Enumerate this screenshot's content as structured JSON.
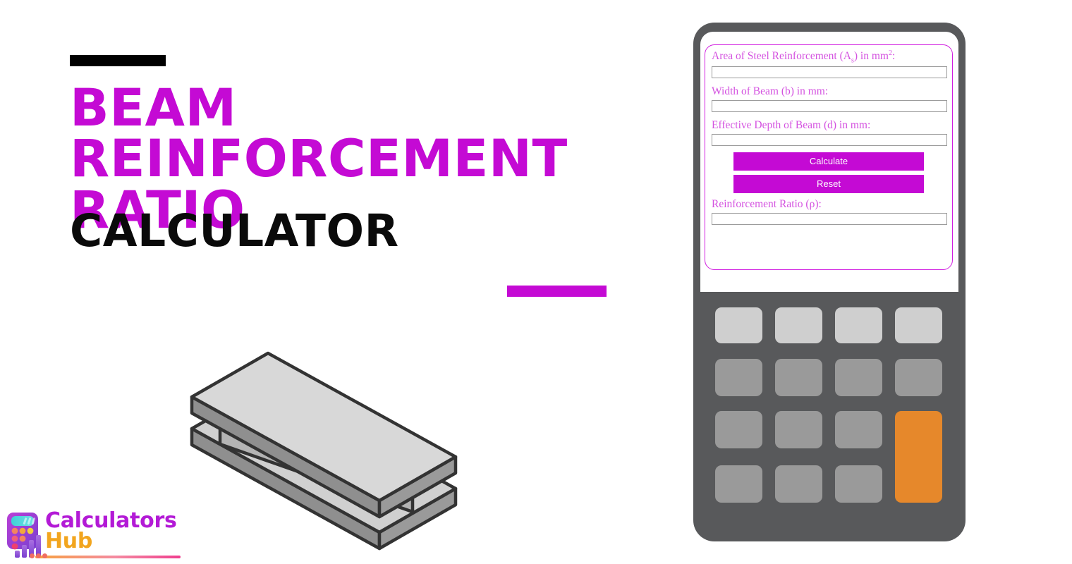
{
  "page": {
    "background_color": "#ffffff",
    "accent_color": "#c40ad4",
    "label_color": "#d452e0",
    "device_color": "#58595b",
    "orange_key_color": "#e6882b"
  },
  "hero": {
    "title_line_1": "Beam Reinforcement",
    "title_line_2": "Ratio",
    "subtitle": "Calculator",
    "rule_top": "black-rule",
    "rule_bottom": "magenta-rule"
  },
  "illustration": {
    "name": "steel-i-beam",
    "face_top_color": "#d8d8d8",
    "face_side_color": "#8f8f8f",
    "face_web_color": "#b0b0b0",
    "outline_color": "#333333"
  },
  "calculator": {
    "form": {
      "fields": [
        {
          "name": "area-of-steel",
          "label_prefix": "Area of Steel Reinforcement (A",
          "label_sub": "s",
          "label_mid": ") in mm",
          "label_sup": "2",
          "label_suffix": ":",
          "value": "",
          "placeholder": ""
        },
        {
          "name": "width-of-beam",
          "label": "Width of Beam (b) in mm:",
          "value": "",
          "placeholder": ""
        },
        {
          "name": "effective-depth",
          "label": "Effective Depth of Beam (d) in mm:",
          "value": "",
          "placeholder": ""
        }
      ],
      "calculate_label": "Calculate",
      "reset_label": "Reset",
      "result_label": "Reinforcement Ratio (ρ):",
      "result_value": "",
      "result_placeholder": ""
    },
    "keypad": {
      "rows": 4,
      "columns": 4,
      "top_row_color": "#cfcfcf",
      "body_key_color": "#9a9a9a",
      "accent_key_color": "#e6882b",
      "accent_key_position": "column-4-rows-3-4"
    }
  },
  "logo": {
    "word_1": "Calculators",
    "word_2": "Hub",
    "icon_name": "calculator-bars-icon",
    "word_1_color": "#b31ad6",
    "word_2_color": "#f2a51e"
  }
}
